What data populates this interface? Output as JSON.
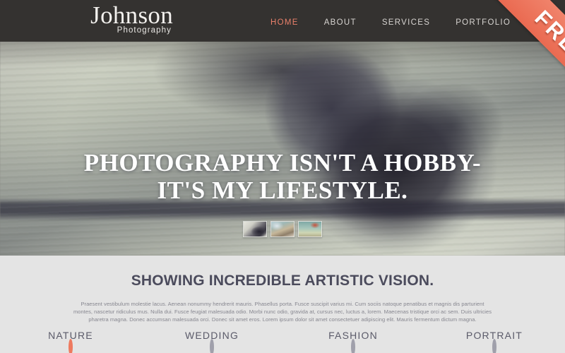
{
  "header": {
    "logo": {
      "main": "Johnson",
      "sub": "Photography"
    },
    "nav": [
      {
        "label": "HOME",
        "active": true
      },
      {
        "label": "ABOUT",
        "active": false
      },
      {
        "label": "SERVICES",
        "active": false
      },
      {
        "label": "PORTFOLIO",
        "active": false
      }
    ],
    "ribbon": {
      "label": "FREE",
      "color": "#ea6a51"
    },
    "background_color": "#343230"
  },
  "hero": {
    "headline_line1": "PHOTOGRAPHY ISN'T A HOBBY-",
    "headline_line2": "IT'S MY LIFESTYLE.",
    "thumbnails": [
      {
        "name": "thumbnail-1"
      },
      {
        "name": "thumbnail-2"
      },
      {
        "name": "thumbnail-3"
      }
    ]
  },
  "main": {
    "section_title": "SHOWING INCREDIBLE ARTISTIC VISION.",
    "paragraph": "Praesent vestibulum molestie lacus. Aenean nonummy hendrerit mauris. Phasellus porta. Fusce suscipit varius mi. Cum sociis natoque penatibus et magnis dis parturient montes, nascetur ridiculus mus. Nulla dui. Fusce feugiat malesuada odio. Morbi nunc odio, gravida at, cursus nec, luctus a, lorem. Maecenas tristique orci ac sem. Duis ultricies pharetra magna. Donec accumsan malesuada orci. Donec sit amet eros. Lorem ipsum dolor sit amet consectetuer adipiscing elit. Mauris fermentum dictum magna.",
    "background_color": "#e4e4e4",
    "title_color": "#4b4b5c",
    "categories": [
      {
        "label": "NATURE",
        "active": true,
        "accent": "#ee7a5f"
      },
      {
        "label": "WEDDING",
        "active": false,
        "accent": "#a0a0ab"
      },
      {
        "label": "FASHION",
        "active": false,
        "accent": "#a0a0ab"
      },
      {
        "label": "PORTRAIT",
        "active": false,
        "accent": "#a0a0ab"
      }
    ]
  }
}
